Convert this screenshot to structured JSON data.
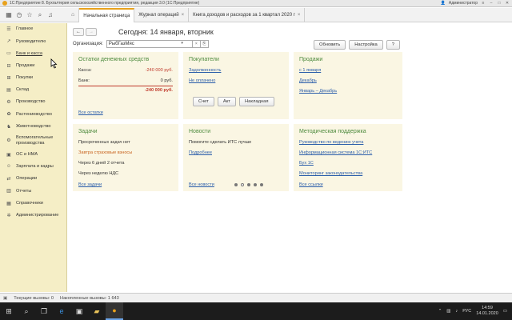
{
  "window": {
    "title": "1С:Предприятие 8. Бухгалтерия сельскохозяйственного предприятия, редакция 3.0  (1С:Предприятие)",
    "user": "Администратор"
  },
  "tabs": [
    {
      "label": "Начальная страница",
      "active": true
    },
    {
      "label": "Журнал операций",
      "active": false
    },
    {
      "label": "Книга доходов и расходов за 1 квартал 2020 г",
      "active": false
    }
  ],
  "sidebar": {
    "items": [
      {
        "label": "Главное",
        "icon": "menu-icon"
      },
      {
        "label": "Руководителю",
        "icon": "chart-icon"
      },
      {
        "label": "Банк и касса",
        "icon": "bank-icon"
      },
      {
        "label": "Продажи",
        "icon": "cart-icon"
      },
      {
        "label": "Покупки",
        "icon": "basket-icon"
      },
      {
        "label": "Склад",
        "icon": "box-icon"
      },
      {
        "label": "Производство",
        "icon": "factory-icon"
      },
      {
        "label": "Растениеводство",
        "icon": "plant-icon"
      },
      {
        "label": "Животноводство",
        "icon": "animal-icon"
      },
      {
        "label": "Вспомогательные производства",
        "icon": "gear-icon"
      },
      {
        "label": "ОС и НМА",
        "icon": "building-icon"
      },
      {
        "label": "Зарплата и кадры",
        "icon": "people-icon"
      },
      {
        "label": "Операции",
        "icon": "operations-icon"
      },
      {
        "label": "Отчеты",
        "icon": "report-icon"
      },
      {
        "label": "Справочники",
        "icon": "book-icon"
      },
      {
        "label": "Администрирование",
        "icon": "settings-icon"
      }
    ]
  },
  "main": {
    "title": "Сегодня: 14 января, вторник",
    "org_label": "Организация:",
    "org_value": "РыбГазМяс",
    "update_btn": "Обновить",
    "settings_btn": "Настройка",
    "help_btn": "?"
  },
  "panels": {
    "cash": {
      "title": "Остатки денежных средств",
      "kassa_label": "Касса:",
      "kassa_value": "-240 000 руб.",
      "bank_label": "Банк:",
      "bank_value": "0 руб.",
      "total": "-240 000 руб.",
      "link": "Все остатки"
    },
    "buyers": {
      "title": "Покупатели",
      "debt": "Задолженность",
      "unpaid": "Не оплачено",
      "btn_invoice": "Счет",
      "btn_act": "Акт",
      "btn_waybill": "Накладная"
    },
    "sales": {
      "title": "Продажи",
      "links": [
        "с 1 января",
        "Декабрь",
        "Январь – Декабрь"
      ]
    },
    "tasks": {
      "title": "Задачи",
      "overdue": "Просроченных задач нет",
      "tomorrow": "Завтра страховые взносы",
      "in6days": "Через 6 дней 2 отчета",
      "nextweek": "Через неделю НДС",
      "link": "Все задачи"
    },
    "news": {
      "title": "Новости",
      "text": "Помогите сделать ИТС лучше",
      "more": "Подробнее",
      "link": "Все новости"
    },
    "support": {
      "title": "Методическая поддержка",
      "links": [
        "Руководство по ведению учета",
        "Информационная система 1С:ИТС",
        "Бух 1С",
        "Мониторинг законодательства"
      ],
      "all": "Все ссылки"
    }
  },
  "status": {
    "current_calls": "Текущие вызовы: 0",
    "accum_calls": "Накопленные вызовы: 1 643"
  },
  "taskbar": {
    "lang": "РУС",
    "time": "14:59",
    "date": "14.01.2020"
  }
}
